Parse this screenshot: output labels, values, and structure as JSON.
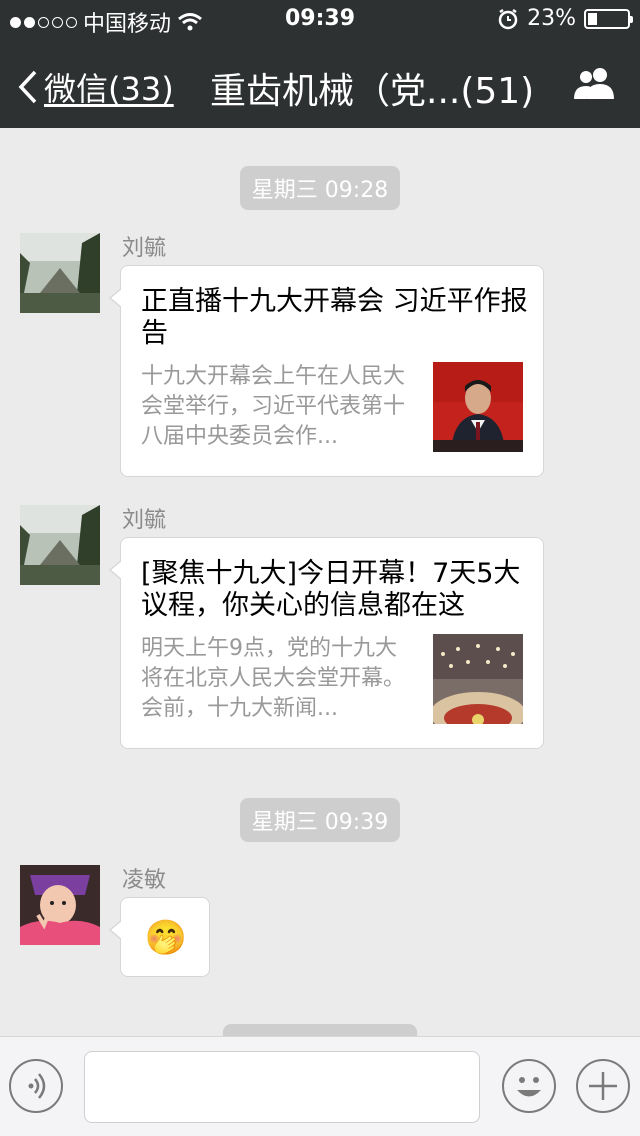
{
  "status_bar": {
    "carrier": "中国移动",
    "time": "09:39",
    "battery": "23%",
    "battery_level": 0.23
  },
  "nav": {
    "back_label": "微信(33)",
    "title": "重齿机械（党...(51)",
    "members_icon": "people-icon"
  },
  "messages": [
    {
      "type": "timestamp",
      "text": "星期三 09:28"
    },
    {
      "type": "article",
      "sender": "刘毓",
      "title": "正直播十九大开幕会 习近平作报告",
      "desc": "十九大开幕会上午在人民大会堂举行，习近平代表第十八届中央委员会作..."
    },
    {
      "type": "article",
      "sender": "刘毓",
      "title": "[聚焦十九大]今日开幕！7天5大议程，你关心的信息都在这",
      "desc": "明天上午9点，党的十九大将在北京人民大会堂开幕。会前，十九大新闻..."
    },
    {
      "type": "timestamp",
      "text": "星期三 09:39"
    },
    {
      "type": "emoji",
      "sender": "凌敏",
      "emoji": "🤭"
    }
  ],
  "input_bar": {
    "voice_icon": "voice-icon",
    "emoji_icon": "smiley-icon",
    "plus_icon": "plus-icon",
    "text": ""
  }
}
